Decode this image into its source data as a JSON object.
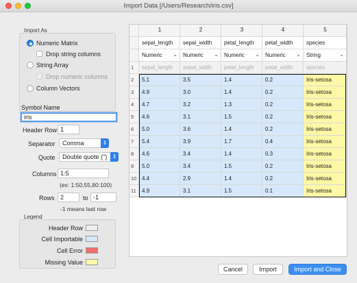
{
  "window": {
    "title": "Import Data [/Users/Research/iris.csv]"
  },
  "import_as": {
    "label": "Import As",
    "numeric_matrix": "Numeric Matrix",
    "drop_string_columns": "Drop string columns",
    "string_array": "String Array",
    "drop_numeric_columns": "Drop numeric columns",
    "column_vectors": "Column Vectors",
    "selected": "Numeric Matrix"
  },
  "symbol_name": {
    "label": "Symbol Name",
    "value": "iris"
  },
  "header_row": {
    "label": "Header Row",
    "value": "1"
  },
  "separator": {
    "label": "Separator",
    "value": "Comma"
  },
  "quote": {
    "label": "Quote",
    "value": "Double quote (\")"
  },
  "columns": {
    "label": "Columns",
    "value": "1:5",
    "hint": "(ex: 1:50,55,80:100)"
  },
  "rows": {
    "label": "Rows",
    "from": "2",
    "to_label": "to",
    "to": "-1",
    "hint": "-1 means last row"
  },
  "legend": {
    "label": "Legend",
    "items": [
      {
        "label": "Header Row",
        "color": "#efefef"
      },
      {
        "label": "Cell Importable",
        "color": "#d6e8fa"
      },
      {
        "label": "Cell Error",
        "color": "#f26d6d"
      },
      {
        "label": "Missing Value",
        "color": "#fdf8a6"
      }
    ]
  },
  "table": {
    "column_numbers": [
      "1",
      "2",
      "3",
      "4",
      "5"
    ],
    "column_names": [
      "sepal_length",
      "sepal_width",
      "petal_length",
      "petal_width",
      "species"
    ],
    "column_types": [
      "Numeric",
      "Numeric",
      "Numeric",
      "Numeric",
      "String"
    ],
    "header_row_num": "1",
    "rows": [
      {
        "n": "2",
        "cells": [
          "5.1",
          "3.5",
          "1.4",
          "0.2",
          "Iris-setosa"
        ]
      },
      {
        "n": "3",
        "cells": [
          "4.9",
          "3.0",
          "1.4",
          "0.2",
          "Iris-setosa"
        ]
      },
      {
        "n": "4",
        "cells": [
          "4.7",
          "3.2",
          "1.3",
          "0.2",
          "Iris-setosa"
        ]
      },
      {
        "n": "5",
        "cells": [
          "4.6",
          "3.1",
          "1.5",
          "0.2",
          "Iris-setosa"
        ]
      },
      {
        "n": "6",
        "cells": [
          "5.0",
          "3.6",
          "1.4",
          "0.2",
          "Iris-setosa"
        ]
      },
      {
        "n": "7",
        "cells": [
          "5.4",
          "3.9",
          "1.7",
          "0.4",
          "Iris-setosa"
        ]
      },
      {
        "n": "8",
        "cells": [
          "4.6",
          "3.4",
          "1.4",
          "0.3",
          "Iris-setosa"
        ]
      },
      {
        "n": "9",
        "cells": [
          "5.0",
          "3.4",
          "1.5",
          "0.2",
          "Iris-setosa"
        ]
      },
      {
        "n": "10",
        "cells": [
          "4.4",
          "2.9",
          "1.4",
          "0.2",
          "Iris-setosa"
        ]
      },
      {
        "n": "11",
        "cells": [
          "4.9",
          "3.1",
          "1.5",
          "0.1",
          "Iris-setosa"
        ]
      }
    ]
  },
  "buttons": {
    "cancel": "Cancel",
    "import": "Import",
    "import_and_close": "Import and Close"
  }
}
